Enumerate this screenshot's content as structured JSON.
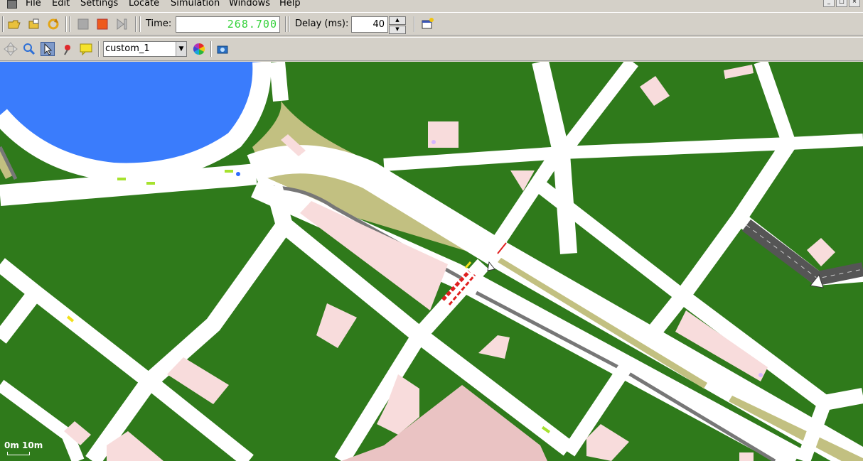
{
  "menu": {
    "items": [
      "File",
      "Edit",
      "Settings",
      "Locate",
      "Simulation",
      "Windows",
      "Help"
    ]
  },
  "toolbar": {
    "time_label": "Time:",
    "time_value": "268.700",
    "delay_label": "Delay (ms):",
    "delay_value": "40"
  },
  "view_toolbar": {
    "scheme": "custom_1"
  },
  "map": {
    "scale_text": "0m  10m",
    "colors": {
      "grass": "#2f7a1b",
      "road": "#ffffff",
      "water": "#3a7cfc",
      "building": "#f8dcdc",
      "median": "#c2c081",
      "rail": "#777777"
    }
  }
}
